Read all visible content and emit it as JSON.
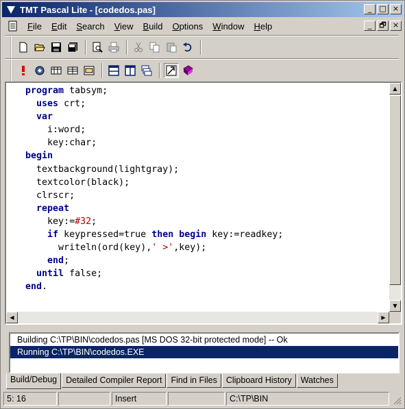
{
  "window": {
    "title": "TMT Pascal Lite - [codedos.pas]"
  },
  "controls": {
    "minimize": "_",
    "maximize": "□",
    "close": "×",
    "restore": "🗗"
  },
  "menu": [
    {
      "label": "File",
      "name": "menu-file"
    },
    {
      "label": "Edit",
      "name": "menu-edit"
    },
    {
      "label": "Search",
      "name": "menu-search"
    },
    {
      "label": "View",
      "name": "menu-view"
    },
    {
      "label": "Build",
      "name": "menu-build"
    },
    {
      "label": "Options",
      "name": "menu-options"
    },
    {
      "label": "Window",
      "name": "menu-window"
    },
    {
      "label": "Help",
      "name": "menu-help"
    }
  ],
  "toolbar1": [
    "new-file-icon",
    "open-folder-icon",
    "save-icon",
    "save-all-icon",
    "print-preview-icon",
    "print-icon",
    "cut-icon",
    "copy-icon",
    "paste-icon",
    "undo-icon"
  ],
  "toolbar2": [
    "run-icon",
    "compile-icon",
    "make-icon",
    "build-all-icon",
    "debug-icon",
    "split-horizontal-icon",
    "split-vertical-icon",
    "cascade-windows-icon",
    "view-icon",
    "help-book-icon"
  ],
  "editor": {
    "lines": [
      "program tabsym;",
      "  uses crt;",
      "  var",
      "    i:word;",
      "    key:char;",
      "begin",
      "  textbackground(lightgray);",
      "  textcolor(black);",
      "  clrscr;",
      "  repeat",
      "    key:=#32;",
      "    if keypressed=true then begin key:=readkey;",
      "      writeln(ord(key),' >',key);",
      "    end;",
      "  until false;",
      "end."
    ],
    "keywords": [
      "program",
      "uses",
      "var",
      "begin",
      "repeat",
      "if",
      "then",
      "end",
      "until"
    ]
  },
  "output": [
    {
      "text": "Building C:\\TP\\BIN\\codedos.pas  [MS DOS 32-bit protected mode] -- Ok",
      "selected": false
    },
    {
      "text": "Running C:\\TP\\BIN\\codedos.EXE",
      "selected": true
    }
  ],
  "tabs": [
    "Build/Debug",
    "Detailed Compiler Report",
    "Find in Files",
    "Clipboard History",
    "Watches"
  ],
  "status": {
    "position": "5:  16",
    "mode": "Insert",
    "path": "C:\\TP\\BIN"
  },
  "colors": {
    "title_start": "#0a246a",
    "title_end": "#a6caf0",
    "keyword": "#00008b",
    "string": "#b00000",
    "selection": "#0a246a"
  }
}
